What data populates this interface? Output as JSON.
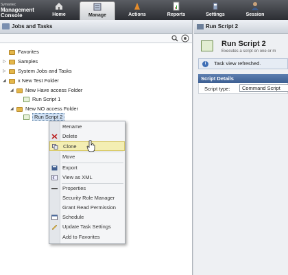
{
  "brand": {
    "vendor": "Symantec",
    "line1": "Management",
    "line2": "Console"
  },
  "nav": [
    {
      "label": "Home",
      "icon": "home-icon"
    },
    {
      "label": "Manage",
      "icon": "manage-icon"
    },
    {
      "label": "Actions",
      "icon": "actions-icon"
    },
    {
      "label": "Reports",
      "icon": "reports-icon"
    },
    {
      "label": "Settings",
      "icon": "settings-icon"
    },
    {
      "label": "Session",
      "icon": "session-icon"
    }
  ],
  "left": {
    "title": "Jobs and Tasks",
    "tree": [
      {
        "label": "Favorites",
        "type": "folder"
      },
      {
        "label": "Samples",
        "type": "folder"
      },
      {
        "label": "System Jobs and Tasks",
        "type": "folder"
      },
      {
        "label": "x New Test Folder",
        "type": "folder"
      },
      {
        "label": "New Have access Folder",
        "type": "folder"
      },
      {
        "label": "Run Script 1",
        "type": "script"
      },
      {
        "label": "New NO access Folder",
        "type": "folder"
      },
      {
        "label": "Run Script 2",
        "type": "script",
        "selected": true
      }
    ]
  },
  "context_menu": [
    {
      "label": "Rename",
      "icon": ""
    },
    {
      "label": "Delete",
      "icon": "delete-icon"
    },
    {
      "label": "Clone",
      "icon": "clone-icon",
      "highlighted": true
    },
    {
      "label": "Move",
      "icon": ""
    },
    {
      "label": "Export",
      "icon": "export-icon"
    },
    {
      "label": "View as XML",
      "icon": "xml-icon"
    },
    {
      "label": "Properties",
      "icon": "properties-icon"
    },
    {
      "label": "Security Role Manager",
      "icon": ""
    },
    {
      "label": "Grant Read Permission",
      "icon": ""
    },
    {
      "label": "Schedule",
      "icon": "schedule-icon"
    },
    {
      "label": "Update Task Settings",
      "icon": "pencil-icon"
    },
    {
      "label": "Add to Favorites",
      "icon": ""
    }
  ],
  "right": {
    "header": "Run Script 2",
    "title": "Run Script 2",
    "subtitle": "Executes a script on one or m",
    "info": "Task view refreshed.",
    "section": "Script Details",
    "script_type_label": "Script type:",
    "script_type_value": "Command Script"
  },
  "colors": {
    "highlight": "#f4eeb3",
    "section_header": "#4a6ea3",
    "folder": "#e3b64a"
  }
}
